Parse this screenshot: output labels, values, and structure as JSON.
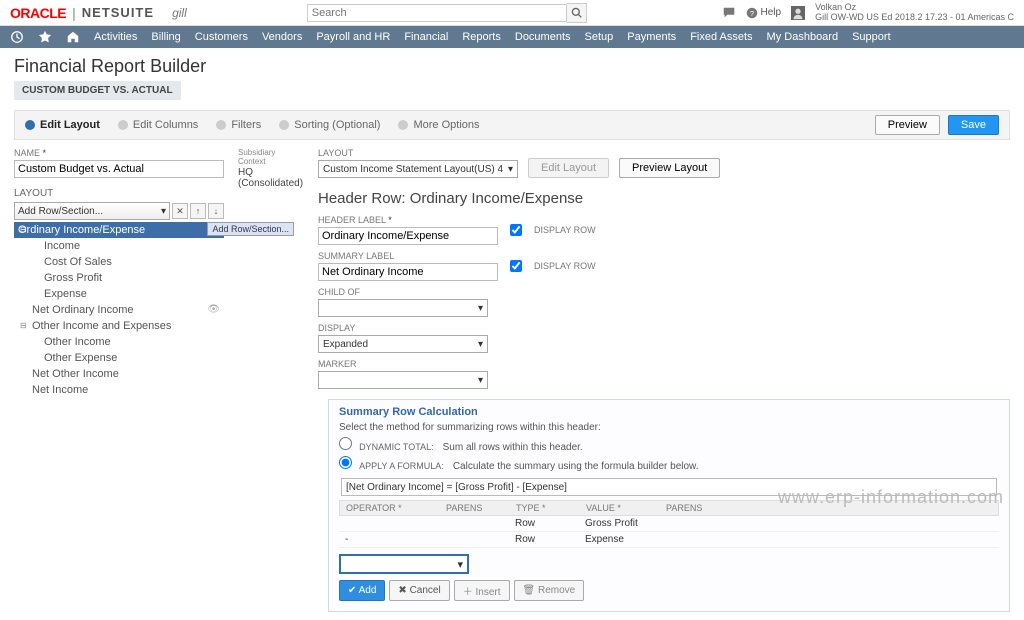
{
  "top": {
    "oracle": "ORACLE",
    "netsuite": "NETSUITE",
    "partner": "gill",
    "search_placeholder": "Search",
    "help": "Help",
    "user_name": "Volkan Oz",
    "user_detail": "Gill OW-WD US Ed 2018.2 17.23 - 01 Americas C"
  },
  "nav": {
    "items": [
      "Activities",
      "Billing",
      "Customers",
      "Vendors",
      "Payroll and HR",
      "Financial",
      "Reports",
      "Documents",
      "Setup",
      "Payments",
      "Fixed Assets",
      "My Dashboard",
      "Support"
    ]
  },
  "page": {
    "title": "Financial Report Builder",
    "subtitle": "CUSTOM BUDGET VS. ACTUAL"
  },
  "tabs": {
    "items": [
      "Edit Layout",
      "Edit Columns",
      "Filters",
      "Sorting (Optional)",
      "More Options"
    ],
    "preview": "Preview",
    "save": "Save"
  },
  "left": {
    "name_label": "NAME",
    "name_value": "Custom Budget vs. Actual",
    "layout_label": "LAYOUT",
    "add_row_section": "Add Row/Section...",
    "add_hint": "Add Row/Section...",
    "tree": [
      "Ordinary Income/Expense",
      "Income",
      "Cost Of Sales",
      "Gross Profit",
      "Expense",
      "Net Ordinary Income",
      "Other Income and Expenses",
      "Other Income",
      "Other Expense",
      "Net Other Income",
      "Net Income"
    ]
  },
  "mid": {
    "sub_label": "Subsidiary Context",
    "sub_value": "HQ (Consolidated)"
  },
  "right": {
    "layout_label": "LAYOUT",
    "layout_value": "Custom Income Statement Layout(US) 4",
    "edit_layout": "Edit Layout",
    "preview_layout": "Preview Layout",
    "header": "Header Row: Ordinary Income/Expense",
    "header_label_lbl": "HEADER LABEL",
    "header_label_val": "Ordinary Income/Expense",
    "display_row": "DISPLAY ROW",
    "summary_label_lbl": "SUMMARY LABEL",
    "summary_label_val": "Net Ordinary Income",
    "child_of_lbl": "CHILD OF",
    "display_lbl": "DISPLAY",
    "display_val": "Expanded",
    "marker_lbl": "MARKER"
  },
  "summary": {
    "title": "Summary Row Calculation",
    "instruction": "Select the method for summarizing rows within this header:",
    "opt1_label": "DYNAMIC TOTAL:",
    "opt1_desc": "Sum all rows within this header.",
    "opt2_label": "APPLY A FORMULA:",
    "opt2_desc": "Calculate the summary using the formula builder below.",
    "formula": "[Net Ordinary Income] = [Gross Profit] - [Expense]",
    "grid_headers": [
      "OPERATOR *",
      "PARENS",
      "TYPE *",
      "VALUE *",
      "PARENS"
    ],
    "rows": [
      {
        "type": "Row",
        "value": "Gross Profit"
      },
      {
        "type": "Row",
        "value": "Expense"
      }
    ],
    "add": "Add",
    "cancel": "Cancel",
    "insert": "Insert",
    "remove": "Remove"
  },
  "watermark": "www.erp-information.com"
}
